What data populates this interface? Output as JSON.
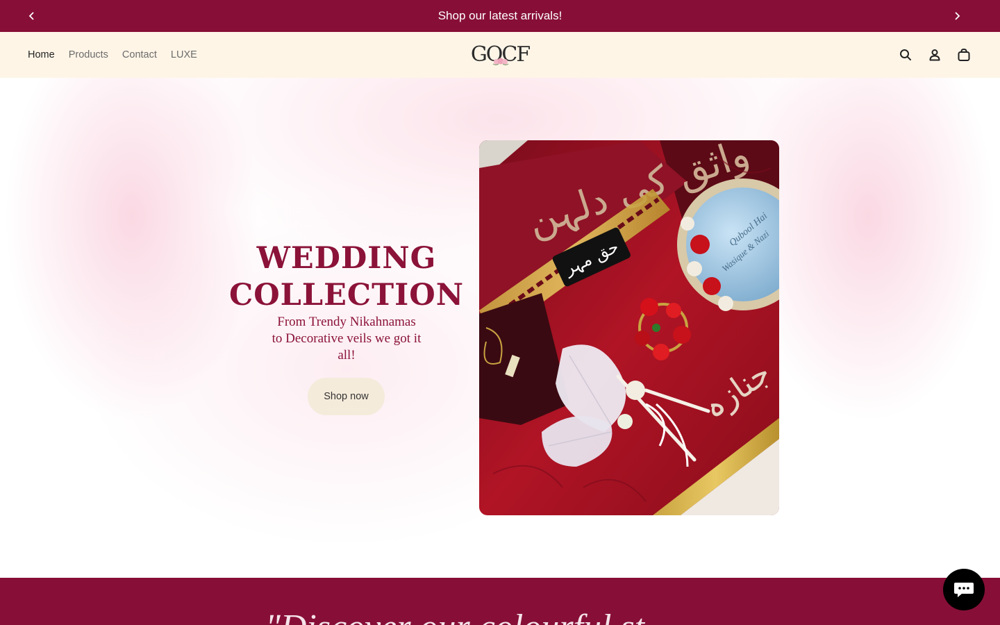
{
  "announcement": {
    "text": "Shop our latest arrivals!",
    "prev_icon": "chevron-left-icon",
    "next_icon": "chevron-right-icon"
  },
  "header": {
    "nav": [
      {
        "label": "Home",
        "active": true
      },
      {
        "label": "Products",
        "active": false
      },
      {
        "label": "Contact",
        "active": false
      },
      {
        "label": "LUXE",
        "active": false
      }
    ],
    "logo_text": "GOCF",
    "icons": [
      "search-icon",
      "account-icon",
      "cart-icon"
    ]
  },
  "hero": {
    "title_line1": "WEDDING",
    "title_line2": "COLLECTION",
    "subtitle": "From Trendy Nikahnamas to Decorative veils we got it all!",
    "button_label": "Shop now",
    "image_urdu_label": "حق مہر",
    "image_text_top": "واثق کی دلہن",
    "image_text_right": "جنازہ",
    "image_mirror_text": "Qubool Hai",
    "image_mirror_names": "Wasique & Nazi"
  },
  "quote_band": {
    "text": "\"Discover our colourful st"
  },
  "colors": {
    "brand": "#870f37",
    "header_bg": "#fef5e7",
    "button_bg": "#f5ebdb",
    "title": "#8b1238"
  },
  "chat": {
    "icon": "chat-icon"
  }
}
